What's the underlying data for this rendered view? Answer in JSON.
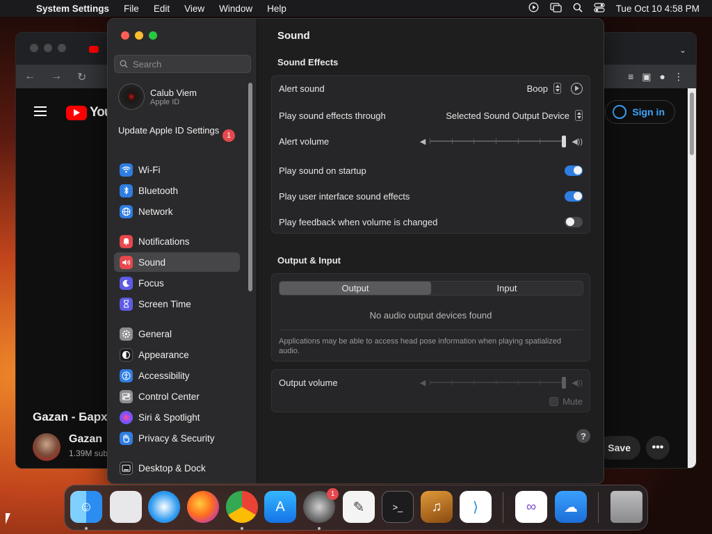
{
  "menubar": {
    "app_name": "System Settings",
    "items": [
      "File",
      "Edit",
      "View",
      "Window",
      "Help"
    ],
    "datetime": "Tue Oct 10  4:58 PM"
  },
  "browser": {
    "youtube_text": "You",
    "sign_in": "Sign in",
    "video_title": "Gazan - Барх",
    "channel_name": "Gazan",
    "channel_subs": "1.39M sub",
    "save_label": "Save",
    "more_label": "•••"
  },
  "sidebar": {
    "search_placeholder": "Search",
    "account_name": "Calub Viem",
    "account_sub": "Apple ID",
    "update_label": "Update Apple ID Settings",
    "update_badge": "1",
    "items": [
      {
        "label": "Wi-Fi",
        "icon": "wifi-icon",
        "color": "#2f7de1"
      },
      {
        "label": "Bluetooth",
        "icon": "bluetooth-icon",
        "color": "#2f7de1"
      },
      {
        "label": "Network",
        "icon": "globe-icon",
        "color": "#2f7de1"
      },
      {
        "label": "Notifications",
        "icon": "bell-icon",
        "color": "#e5484d"
      },
      {
        "label": "Sound",
        "icon": "speaker-icon",
        "color": "#e5484d"
      },
      {
        "label": "Focus",
        "icon": "moon-icon",
        "color": "#5e5ce6"
      },
      {
        "label": "Screen Time",
        "icon": "hourglass-icon",
        "color": "#5e5ce6"
      },
      {
        "label": "General",
        "icon": "gear-icon",
        "color": "#8e8e93"
      },
      {
        "label": "Appearance",
        "icon": "appearance-icon",
        "color": "#1c1c1e"
      },
      {
        "label": "Accessibility",
        "icon": "accessibility-icon",
        "color": "#2f7de1"
      },
      {
        "label": "Control Center",
        "icon": "control-center-icon",
        "color": "#8e8e93"
      },
      {
        "label": "Siri & Spotlight",
        "icon": "siri-icon",
        "color": "#9b59b6"
      },
      {
        "label": "Privacy & Security",
        "icon": "hand-icon",
        "color": "#2f7de1"
      },
      {
        "label": "Desktop & Dock",
        "icon": "dock-icon",
        "color": "#1c1c1e"
      }
    ],
    "selected": "Sound"
  },
  "content": {
    "title": "Sound",
    "sound_effects": {
      "heading": "Sound Effects",
      "alert_sound_label": "Alert sound",
      "alert_sound_value": "Boop",
      "play_through_label": "Play sound effects through",
      "play_through_value": "Selected Sound Output Device",
      "alert_volume_label": "Alert volume",
      "alert_volume_level": 1.0,
      "startup_label": "Play sound on startup",
      "startup_on": true,
      "ui_sounds_label": "Play user interface sound effects",
      "ui_sounds_on": true,
      "feedback_label": "Play feedback when volume is changed",
      "feedback_on": false
    },
    "output_input": {
      "heading": "Output & Input",
      "tabs": [
        "Output",
        "Input"
      ],
      "active_tab": "Output",
      "empty_message": "No audio output devices found",
      "note": "Applications may be able to access head pose information when playing spatialized audio."
    },
    "output_volume": {
      "label": "Output volume",
      "level": 1.0,
      "mute_label": "Mute"
    },
    "help": "?"
  },
  "dock": {
    "apps": [
      "finder-icon",
      "launchpad-icon",
      "safari-icon",
      "firefox-icon",
      "chrome-icon",
      "app-store-icon",
      "system-settings-icon",
      "textedit-icon",
      "terminal-icon",
      "garageband-icon",
      "vscode-icon",
      "visual-studio-icon",
      "weather-icon",
      "trash-icon"
    ],
    "settings_badge": "1"
  }
}
